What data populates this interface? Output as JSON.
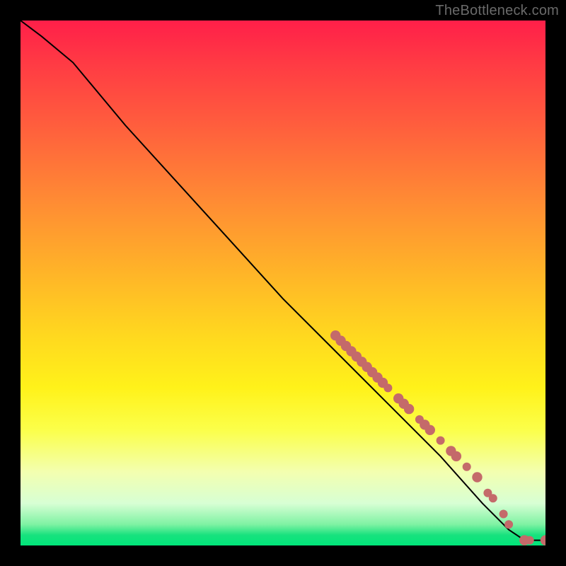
{
  "attribution": "TheBottleneck.com",
  "chart_data": {
    "type": "line",
    "title": "",
    "xlabel": "",
    "ylabel": "",
    "xlim": [
      0,
      100
    ],
    "ylim": [
      0,
      100
    ],
    "curve": [
      {
        "x": 0,
        "y": 100
      },
      {
        "x": 4,
        "y": 97
      },
      {
        "x": 10,
        "y": 92
      },
      {
        "x": 20,
        "y": 80
      },
      {
        "x": 30,
        "y": 69
      },
      {
        "x": 40,
        "y": 58
      },
      {
        "x": 50,
        "y": 47
      },
      {
        "x": 60,
        "y": 37
      },
      {
        "x": 70,
        "y": 27
      },
      {
        "x": 80,
        "y": 17
      },
      {
        "x": 88,
        "y": 8
      },
      {
        "x": 93,
        "y": 3
      },
      {
        "x": 96,
        "y": 1
      },
      {
        "x": 98,
        "y": 1
      },
      {
        "x": 100,
        "y": 1
      }
    ],
    "markers": [
      {
        "x": 60,
        "y": 40,
        "r": 1.2
      },
      {
        "x": 61,
        "y": 39,
        "r": 1.2
      },
      {
        "x": 62,
        "y": 38,
        "r": 1.2
      },
      {
        "x": 63,
        "y": 37,
        "r": 1.2
      },
      {
        "x": 64,
        "y": 36,
        "r": 1.2
      },
      {
        "x": 65,
        "y": 35,
        "r": 1.2
      },
      {
        "x": 66,
        "y": 34,
        "r": 1.2
      },
      {
        "x": 67,
        "y": 33,
        "r": 1.2
      },
      {
        "x": 68,
        "y": 32,
        "r": 1.2
      },
      {
        "x": 69,
        "y": 31,
        "r": 1.2
      },
      {
        "x": 70,
        "y": 30,
        "r": 1.0
      },
      {
        "x": 72,
        "y": 28,
        "r": 1.2
      },
      {
        "x": 73,
        "y": 27,
        "r": 1.2
      },
      {
        "x": 74,
        "y": 26,
        "r": 1.2
      },
      {
        "x": 76,
        "y": 24,
        "r": 1.0
      },
      {
        "x": 77,
        "y": 23,
        "r": 1.2
      },
      {
        "x": 78,
        "y": 22,
        "r": 1.2
      },
      {
        "x": 80,
        "y": 20,
        "r": 1.0
      },
      {
        "x": 82,
        "y": 18,
        "r": 1.2
      },
      {
        "x": 83,
        "y": 17,
        "r": 1.2
      },
      {
        "x": 85,
        "y": 15,
        "r": 1.0
      },
      {
        "x": 87,
        "y": 13,
        "r": 1.2
      },
      {
        "x": 89,
        "y": 10,
        "r": 1.0
      },
      {
        "x": 90,
        "y": 9,
        "r": 1.0
      },
      {
        "x": 92,
        "y": 6,
        "r": 1.0
      },
      {
        "x": 93,
        "y": 4,
        "r": 1.0
      },
      {
        "x": 96,
        "y": 1,
        "r": 1.2
      },
      {
        "x": 97,
        "y": 1,
        "r": 1.0
      },
      {
        "x": 100,
        "y": 1,
        "r": 1.2
      }
    ],
    "colors": {
      "curve": "#000000",
      "marker": "#c46a6a"
    }
  }
}
